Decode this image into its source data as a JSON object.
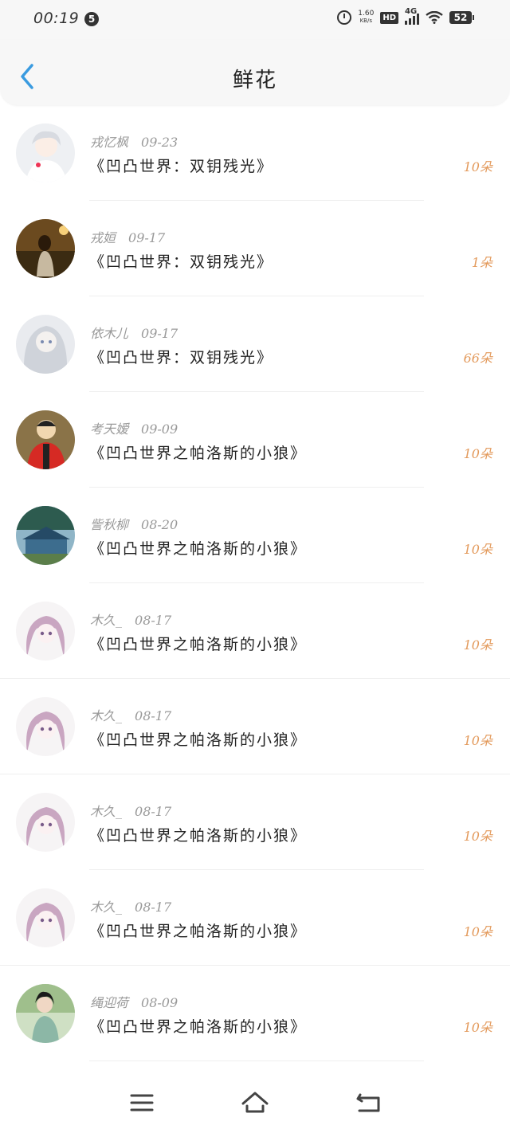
{
  "status_bar": {
    "time": "00:19",
    "notification_count": "5",
    "net_speed_value": "1.60",
    "net_speed_unit": "KB/s",
    "hd_label": "HD",
    "network_label": "4G",
    "battery": "52",
    "icons": [
      "alarm-icon",
      "signal-icon",
      "wifi-icon",
      "battery-icon"
    ]
  },
  "header": {
    "title": "鲜花",
    "back_icon": "chevron-left-icon",
    "accent_color": "#3a9be0"
  },
  "flowers": [
    {
      "user": "戎忆枫",
      "date": "09-23",
      "book": "《凹凸世界：双钥残光》",
      "count": "10朵",
      "avatar": "anime-boy-white-hair"
    },
    {
      "user": "戎姮",
      "date": "09-17",
      "book": "《凹凸世界：双钥残光》",
      "count": "1朵",
      "avatar": "girl-night-street"
    },
    {
      "user": "依木儿",
      "date": "09-17",
      "book": "《凹凸世界：双钥残光》",
      "count": "66朵",
      "avatar": "anime-silver-hair"
    },
    {
      "user": "考天嫒",
      "date": "09-09",
      "book": "《凹凸世界之帕洛斯的小狼》",
      "count": "10朵",
      "avatar": "cartoon-red-jacket"
    },
    {
      "user": "訾秋柳",
      "date": "08-20",
      "book": "《凹凸世界之帕洛斯的小狼》",
      "count": "10朵",
      "avatar": "blue-house-scene"
    },
    {
      "user": "木久_",
      "date": "08-17",
      "book": "《凹凸世界之帕洛斯的小狼》",
      "count": "10朵",
      "avatar": "anime-pink-hair"
    },
    {
      "user": "木久_",
      "date": "08-17",
      "book": "《凹凸世界之帕洛斯的小狼》",
      "count": "10朵",
      "avatar": "anime-pink-hair"
    },
    {
      "user": "木久_",
      "date": "08-17",
      "book": "《凹凸世界之帕洛斯的小狼》",
      "count": "10朵",
      "avatar": "anime-pink-hair"
    },
    {
      "user": "木久_",
      "date": "08-17",
      "book": "《凹凸世界之帕洛斯的小狼》",
      "count": "10朵",
      "avatar": "anime-pink-hair"
    },
    {
      "user": "绳迎荷",
      "date": "08-09",
      "book": "《凹凸世界之帕洛斯的小狼》",
      "count": "10朵",
      "avatar": "girl-outdoor-photo"
    }
  ],
  "nav_bar": {
    "icons": [
      "menu-icon",
      "home-icon",
      "back-icon"
    ]
  },
  "colors": {
    "count_color": "#e39a5c",
    "header_bg": "#f7f7f7",
    "meta_color": "#999999"
  }
}
